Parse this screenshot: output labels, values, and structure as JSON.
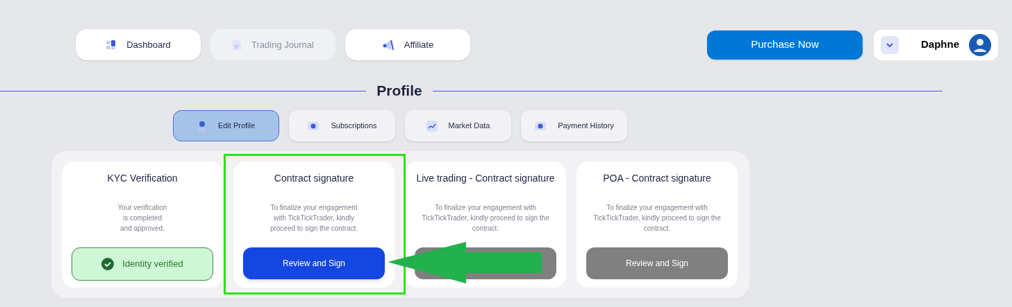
{
  "nav": [
    {
      "label": "Dashboard",
      "kind": "dashboard",
      "disabled": false
    },
    {
      "label": "Trading Journal",
      "kind": "document",
      "disabled": true
    },
    {
      "label": "Affiliate",
      "kind": "megaphone",
      "disabled": false
    }
  ],
  "purchase_button": "Purchase Now",
  "user": {
    "name": "Daphne"
  },
  "heading": "Profile",
  "tabs": [
    {
      "label": "Edit Profile",
      "kind": "person",
      "selected": true
    },
    {
      "label": "Subscriptions",
      "kind": "ticket",
      "selected": false
    },
    {
      "label": "Market Data",
      "kind": "chart",
      "selected": false
    },
    {
      "label": "Payment History",
      "kind": "ticket",
      "selected": false
    }
  ],
  "cards": [
    {
      "title": "KYC Verification",
      "text": "Your verification\nis completed\nand approved.",
      "kind": "status",
      "status": "Identity verified"
    },
    {
      "title": "Contract signature",
      "text": "To finalize your engagement\nwith TickTickTrader, kindly\nproceed to sign the contract.",
      "kind": "button",
      "button": "Review and Sign",
      "disabled": false
    },
    {
      "title": "Live trading - Contract signature",
      "text": "To finalize your engagement with\nTickTickTrader, kindly proceed to sign the\ncontract.",
      "kind": "button",
      "disabled": true
    },
    {
      "title": "POA - Contract signature",
      "text": "To finalize your engagement with\nTickTickTrader, kindly proceed to sign the\ncontract.",
      "kind": "button",
      "button": "Review and Sign",
      "disabled": true
    }
  ],
  "annotation": {
    "highlight_box": true,
    "arrow": true
  }
}
